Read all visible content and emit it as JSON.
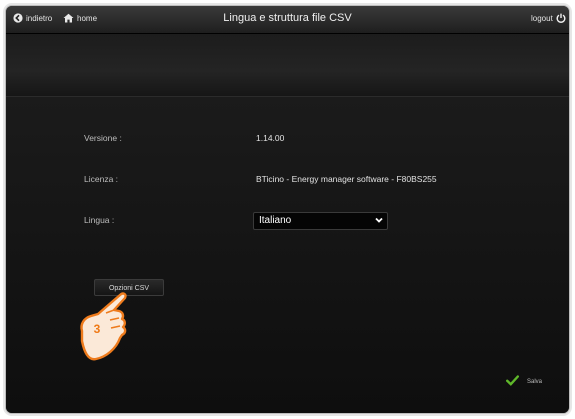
{
  "header": {
    "back_label": "indietro",
    "home_label": "home",
    "title": "Lingua e struttura file CSV",
    "logout_label": "logout",
    "icons": {
      "back": "back-arrow-icon",
      "home": "home-icon",
      "logout": "power-icon"
    }
  },
  "info": {
    "version_label": "Versione :",
    "version_value": "1.14.00",
    "license_label": "Licenza :",
    "license_value": "BTicino - Energy manager software - F80BS255",
    "language_label": "Lingua :",
    "language_selected": "Italiano"
  },
  "buttons": {
    "csv_options_label": "Opzioni CSV",
    "save_label": "Salva"
  },
  "annotation": {
    "step_number": "3",
    "step_color": "#f07a16"
  },
  "colors": {
    "background": "#141414",
    "save_check": "#5fb82a"
  }
}
